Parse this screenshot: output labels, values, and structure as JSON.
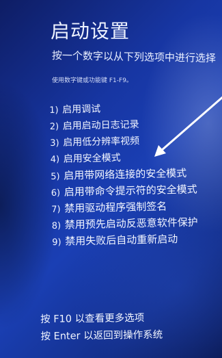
{
  "title": "启动设置",
  "subtitle": "按一个数字以从下列选项中进行选择",
  "hint": "使用数字键或功能键 F1-F9。",
  "options": [
    {
      "num": "1)",
      "label": "启用调试"
    },
    {
      "num": "2)",
      "label": "启用启动日志记录"
    },
    {
      "num": "3)",
      "label": "启用低分辨率视频"
    },
    {
      "num": "4)",
      "label": "启用安全模式"
    },
    {
      "num": "5)",
      "label": "启用带网络连接的安全模式"
    },
    {
      "num": "6)",
      "label": "启用带命令提示符的安全模式"
    },
    {
      "num": "7)",
      "label": "禁用驱动程序强制签名"
    },
    {
      "num": "8)",
      "label": "禁用预先启动反恶意软件保护"
    },
    {
      "num": "9)",
      "label": "禁用失败后自动重新启动"
    }
  ],
  "footer": {
    "more_options": "按 F10 以查看更多选项",
    "return_os": "按 Enter 以返回到操作系统"
  },
  "annotation": {
    "arrow_color": "#ffffff",
    "icon": "arrow-pointer-icon"
  },
  "colors": {
    "background": "#1736a3",
    "text": "#f1f5ff"
  }
}
